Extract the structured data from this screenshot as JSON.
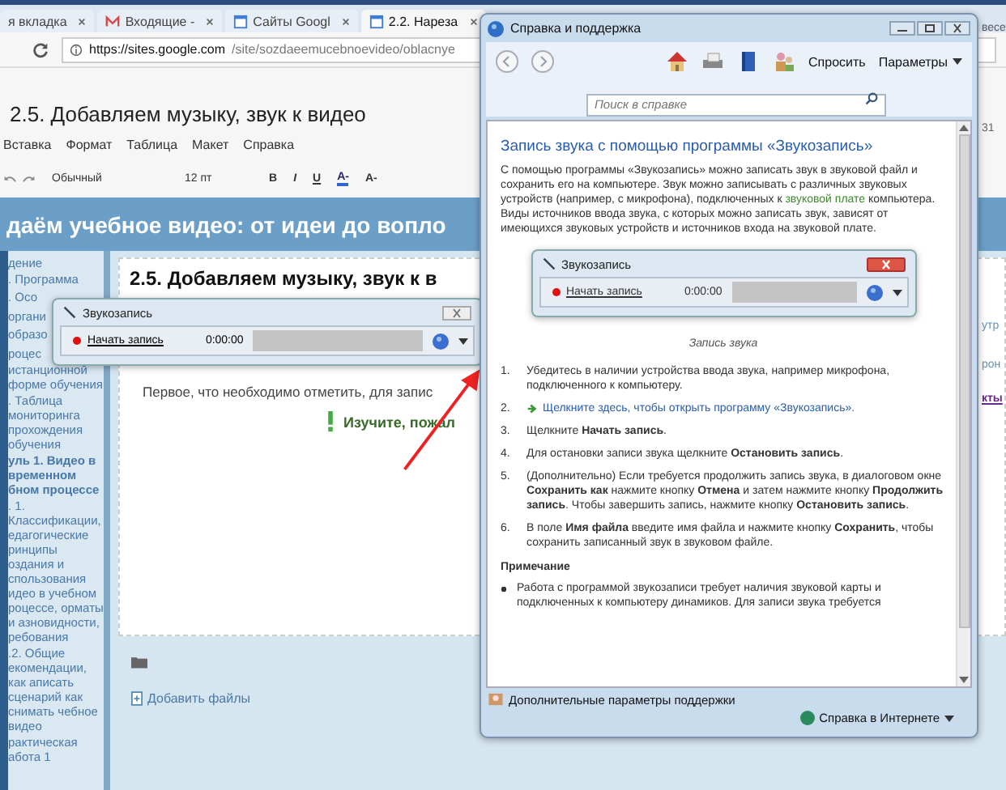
{
  "browser": {
    "tabs": [
      {
        "label": "я вкладка",
        "kind": "blank",
        "selected": false
      },
      {
        "label": "Входящие - ",
        "kind": "mail",
        "selected": false
      },
      {
        "label": "Сайты Googl",
        "kind": "site",
        "selected": false
      },
      {
        "label": "2.2. Нарезa",
        "kind": "site",
        "selected": true
      }
    ],
    "url_host": "https://sites.google.com",
    "url_path": "/site/sozdaeemucebnoevideo/oblacnye",
    "doc_title": "2.5. Добавляем музыку, звук к видео",
    "menu": [
      "Вставка",
      "Формат",
      "Таблица",
      "Макет",
      "Справка"
    ],
    "toolbar": {
      "style": "Обычный",
      "size": "12 пт",
      "buttons": [
        "B",
        "I",
        "U",
        "A-",
        "A-"
      ]
    },
    "banner": "даём учебное видео: от идеи до вопло",
    "sidebar": [
      {
        "label": "дение",
        "kind": "link",
        "bold": false
      },
      {
        "label": ". Программа",
        "kind": "link",
        "bold": false
      },
      {
        "label": ". Осо",
        "kind": "fragment",
        "bold": false
      },
      {
        "label": "органи",
        "kind": "fragment",
        "bold": false
      },
      {
        "label": "образо",
        "kind": "fragment",
        "bold": false
      },
      {
        "label": "роцес",
        "kind": "fragment",
        "bold": false
      },
      {
        "label": "истанционной форме обучения",
        "kind": "link",
        "bold": false
      },
      {
        "label": ". Таблица мониторинга прохождения обучения",
        "kind": "link",
        "bold": false
      },
      {
        "label": "уль 1. Видео в временном бном процессе",
        "kind": "link",
        "bold": true
      },
      {
        "label": ". 1. Классификации, едагогические ринципы оздания и спользования идео в учебном роцессе, орматы и азновидности, ребования",
        "kind": "link",
        "bold": false
      },
      {
        "label": ".2. Общие екомендации, как аписать сценарий как снимать чебное видео",
        "kind": "link",
        "bold": false
      },
      {
        "label": "рактическая абота 1",
        "kind": "link",
        "bold": false
      }
    ],
    "page_heading": "2.5. Добавляем музыку, звук к в",
    "intro": "Первое, что необходимо отметить, для запис",
    "notice": "Изучите, пожал",
    "add_files": "Добавить файлы",
    "right_peek": [
      "весе",
      "31",
      "утр",
      "рон",
      "кты"
    ]
  },
  "recorder": {
    "title": "Звукозапись",
    "button": "Начать запись",
    "time": "0:00:00"
  },
  "help": {
    "title": "Справка и поддержка",
    "ask": "Спросить",
    "options": "Параметры",
    "search": {
      "placeholder": "Поиск в справке"
    },
    "heading": "Запись звука с помощью программы «Звукозапись»",
    "intro_before": "С помощью программы «Звукозапись» можно записать звук в звуковой файл и сохранить его на компьютере. Звук можно записывать с различных звуковых устройств (например, с микрофона), подключенных к ",
    "intro_link": "звуковой плате",
    "intro_after": " компьютера. Виды источников ввода звука, с которых можно записать звук, зависят от имеющихся звуковых устройств и источников входа на звуковой плате.",
    "figure": {
      "title": "Звукозапись",
      "button": "Начать запись",
      "time": "0:00:00",
      "caption": "Запись звука"
    },
    "steps": [
      {
        "num": "1.",
        "kind": "text",
        "text": "Убедитесь в наличии устройства ввода звука, например микрофона, подключенного к компьютеру."
      },
      {
        "num": "2.",
        "kind": "link",
        "text": "Щелкните здесь, чтобы открыть программу «Звукозапись»."
      },
      {
        "num": "3.",
        "kind": "text",
        "text": "Щелкните **Начать запись**."
      },
      {
        "num": "4.",
        "kind": "text",
        "text": "Для остановки записи звука щелкните **Остановить запись**."
      },
      {
        "num": "5.",
        "kind": "text",
        "text": "(Дополнительно) Если требуется продолжить запись звука, в диалоговом окне **Сохранить как** нажмите кнопку **Отмена** и затем нажмите кнопку **Продолжить запись**. Чтобы завершить запись, нажмите кнопку **Остановить запись**."
      },
      {
        "num": "6.",
        "kind": "text",
        "text": "В поле **Имя файла** введите имя файла и нажмите кнопку **Сохранить**, чтобы сохранить записанный звук в звуковом файле."
      }
    ],
    "note_title": "Примечание",
    "note": "Работа с программой звукозаписи требует наличия звуковой карты и подключенных к компьютеру динамиков. Для записи звука требуется",
    "more_support": "Дополнительные параметры поддержки",
    "online": "Справка в Интернете"
  }
}
